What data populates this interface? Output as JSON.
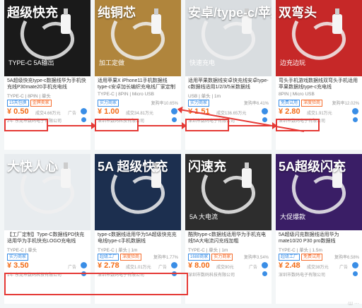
{
  "cards": [
    {
      "img_text": "超级快充",
      "img_sub": "TYPE-C 5A输出",
      "img_bg": "#1a1a1a",
      "title": "5A超级快充type-c数据线华为手机快充线P30mate20手机充电线",
      "meta": "TYPE-C | 8PIN | 单头",
      "tags": [
        "15天包换",
        "金牌卖家"
      ],
      "rate": "",
      "price": "¥ 0.50",
      "sales": "成交4.66万元",
      "ad": "广告",
      "shop": "2年 东莞市数码电子有限公司"
    },
    {
      "img_text": "纯铜芯",
      "img_sub": "加工定做",
      "img_bg": "#b0853c",
      "title": "适用苹果X iPhone11手机数据线type-c安卓加长编织充电线厂家定制",
      "meta": "TYPE-C | 8PIN | Micro USB",
      "tags": [
        "实力商家"
      ],
      "rate": "复购率10.65%",
      "price": "¥ 1.00",
      "sales": "成交34.81万元",
      "ad": "",
      "shop": "深圳市数码科技有限公司"
    },
    {
      "img_text": "安卓/type-c/苹果数据线",
      "img_sub": "快速充电",
      "img_bg": "#d9dde0",
      "title": "适用苹果数据线安卓快充线安卓type-c数据线适用1/2/3/5米数据线",
      "meta": "USB | 单头 | 1m",
      "tags": [
        "实力商家"
      ],
      "rate": "复购率6.41%",
      "price": "¥ 1.51",
      "sales": "成交136.65万元",
      "ad": "",
      "shop": "深圳市数码电子有限公司"
    },
    {
      "img_text": "双弯头",
      "img_sub": "边充边玩",
      "img_bg": "#c62828",
      "title": "弯头手机游戏数据线双弯头手机适用苹果数据线type-c充电线",
      "meta": "8PIN | Micro USB",
      "tags": [
        "免费试用",
        "深度验商"
      ],
      "rate": "复购率12.02%",
      "price": "¥ 2.80",
      "sales": "成交1.91万元",
      "ad": "",
      "shop": "深圳市数码电子有限公司"
    },
    {
      "img_text": "大快人心",
      "img_sub": "",
      "img_bg": "#e8ecef",
      "title": "【工厂定制】Type-C数据线PD快充适用华为手机快充LOGO充电线",
      "meta": "TYPE-C | 单头",
      "tags": [
        "实力商家"
      ],
      "rate": "",
      "price": "¥ 3.50",
      "sales": "",
      "ad": "广告",
      "shop": "1年 东莞市数码科技有限公司"
    },
    {
      "img_text": "5A 超级快充",
      "img_sub": "",
      "img_bg": "#1c2f4f",
      "title": "type-c数据线适用华为5A超级快充充电线type-c手机数据线",
      "meta": "TYPE-C | 单头 | 1m",
      "tags": [
        "超级工厂",
        "深度验商"
      ],
      "rate": "复购率1.77%",
      "price": "¥ 2.78",
      "sales": "成交1.01万元",
      "ad": "广告",
      "shop": "深圳市数码电子有限公司"
    },
    {
      "img_text": "闪速充",
      "img_sub": "5A 大电流",
      "img_bg": "#2d2d2d",
      "title": "酷狗type-c数据线适用华为手机充电线5A大电流闪充线加粗",
      "meta": "TYPE-C | 单头 | 1m",
      "tags": [
        "1688商家",
        "实力商家"
      ],
      "rate": "复购率3.54%",
      "price": "¥ 8.00",
      "sales": "成交90元",
      "ad": "广告",
      "shop": "深圳市数码科技有限公司"
    },
    {
      "img_text": "5A超级闪充",
      "img_sub": "大促爆款",
      "img_bg": "#3a1e66",
      "title": "5A超级闪充数据线适用华为mate10/20 P30 pro数据线",
      "meta": "TYPE-C | 单头 | 1.5m",
      "tags": [
        "超级工厂",
        "免费试用"
      ],
      "rate": "复购率6.58%",
      "price": "¥ 2.48",
      "sales": "成交38万元",
      "ad": "广告",
      "shop": "深圳市数码电子有限公司"
    }
  ],
  "watermark": "·Ш ⋯"
}
